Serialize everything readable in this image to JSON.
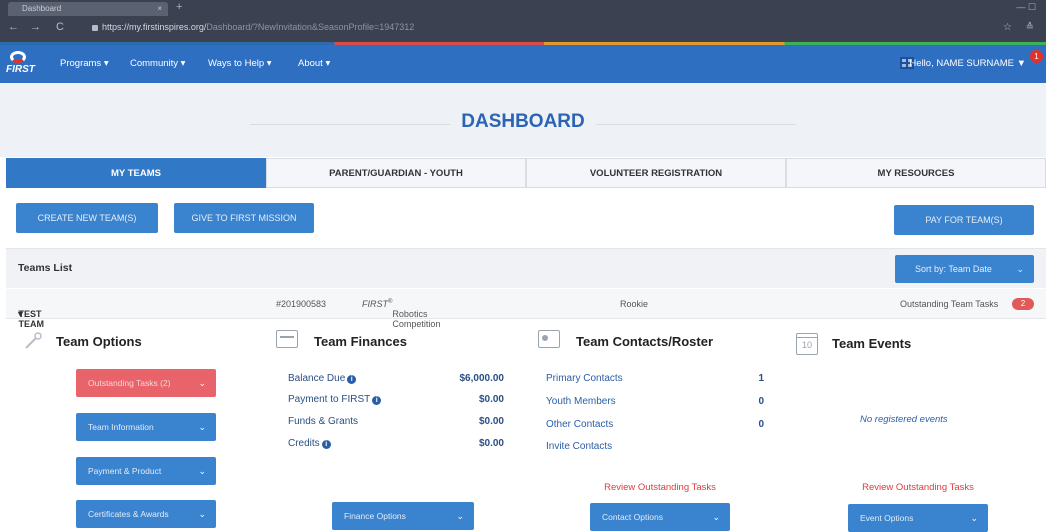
{
  "browser": {
    "tab_title": "Dashboard",
    "url_host": "https://my.firstinspires.org/",
    "url_path": "Dashboard/?NewInvitation&SeasonProfile=1947312"
  },
  "nav": {
    "logo_text": "FIRST",
    "items": [
      "Programs",
      "Community",
      "Ways to Help",
      "About"
    ],
    "user": "Hello, NAME SURNAME",
    "notification_count": "1"
  },
  "hero": {
    "title": "DASHBOARD"
  },
  "tabs": [
    "MY TEAMS",
    "PARENT/GUARDIAN - YOUTH",
    "VOLUNTEER REGISTRATION",
    "MY RESOURCES"
  ],
  "actions": {
    "create": "CREATE NEW TEAM(S)",
    "give": "GIVE TO FIRST MISSION",
    "pay": "PAY FOR TEAM(S)",
    "sort": "Sort by: Team Date"
  },
  "list": {
    "title": "Teams List"
  },
  "team": {
    "name": "TEST TEAM",
    "number": "#201900583",
    "program_prefix": "FIRST",
    "program_suffix": " Robotics Competition",
    "status": "Rookie",
    "tasks_label": "Outstanding Team Tasks",
    "tasks_count": "2"
  },
  "options": {
    "title": "Team Options",
    "items": [
      "Outstanding Tasks (2)",
      "Team Information",
      "Payment & Product",
      "Certificates & Awards"
    ]
  },
  "finances": {
    "title": "Team Finances",
    "rows": [
      {
        "label": "Balance Due",
        "value": "$6,000.00"
      },
      {
        "label": "Payment to FIRST",
        "value": "$0.00"
      },
      {
        "label": "Funds & Grants",
        "value": "$0.00"
      },
      {
        "label": "Credits",
        "value": "$0.00"
      }
    ],
    "button": "Finance Options"
  },
  "contacts": {
    "title": "Team Contacts/Roster",
    "rows": [
      {
        "label": "Primary Contacts",
        "value": "1"
      },
      {
        "label": "Youth Members",
        "value": "0"
      },
      {
        "label": "Other Contacts",
        "value": "0"
      },
      {
        "label": "Invite Contacts",
        "value": ""
      }
    ],
    "review": "Review Outstanding Tasks",
    "button": "Contact Options"
  },
  "events": {
    "title": "Team Events",
    "calendar_day": "10",
    "empty": "No registered events",
    "review": "Review Outstanding Tasks",
    "button": "Event Options"
  }
}
